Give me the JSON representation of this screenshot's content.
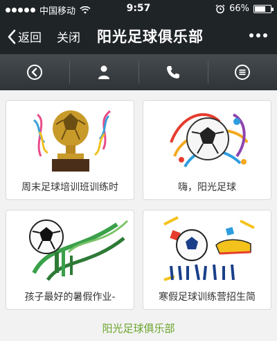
{
  "status_bar": {
    "carrier": "中国移动",
    "time": "9:57",
    "battery": "66%",
    "battery_level": 0.66,
    "signal_bars": 5,
    "icons": [
      "signal-dots-icon",
      "wifi-icon",
      "alarm-clock-icon",
      "battery-icon"
    ]
  },
  "nav": {
    "back_label": "返回",
    "close_label": "关闭",
    "title": "阳光足球俱乐部",
    "icons": [
      "chevron-left-icon",
      "more-dots-icon"
    ]
  },
  "toolbar": {
    "items": [
      {
        "icon": "circle-back-icon"
      },
      {
        "icon": "user-icon"
      },
      {
        "icon": "phone-icon"
      },
      {
        "icon": "menu-list-icon"
      }
    ]
  },
  "cards": [
    {
      "title": "周末足球培训班训练时",
      "image": "golden-trophy-football-illustration"
    },
    {
      "title": "嗨，阳光足球",
      "image": "colorful-splash-football-illustration"
    },
    {
      "title": "孩子最好的暑假作业-",
      "image": "green-splash-football-illustration"
    },
    {
      "title": "寒假足球训练营招生简",
      "image": "football-boots-illustration"
    }
  ],
  "footer": {
    "link_text": "阳光足球俱乐部"
  },
  "colors": {
    "bar_bg": "#1f2427",
    "toolbar_bg": "#3a3f43",
    "page_bg": "#f2f2f2",
    "footer_link": "#6aa32a"
  }
}
